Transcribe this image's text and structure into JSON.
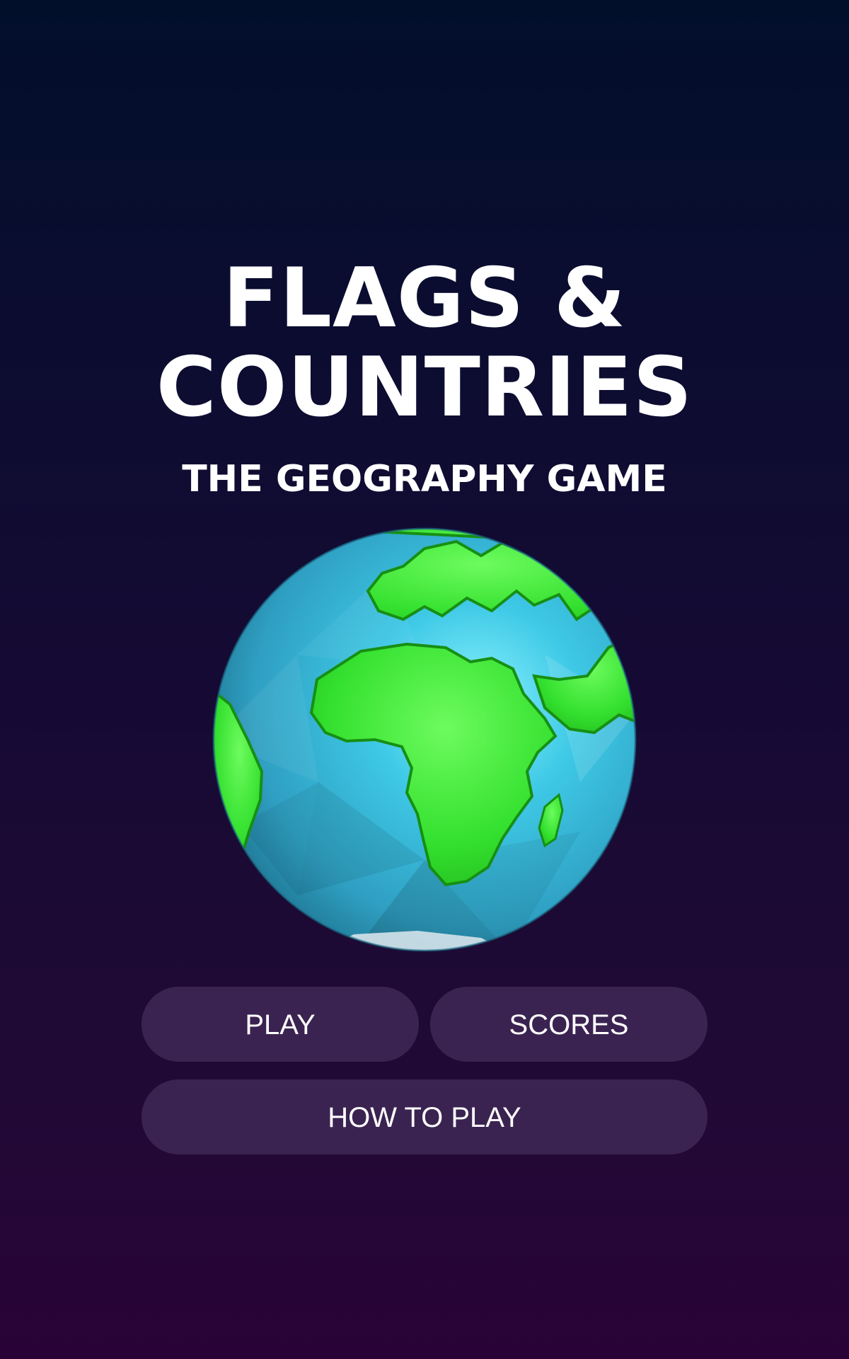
{
  "title": {
    "line1": "FLAGS &",
    "line2": "COUNTRIES"
  },
  "subtitle": "THE GEOGRAPHY GAME",
  "globe": {
    "icon": "earth-globe-icon",
    "ocean_color": "#3fb6d6",
    "land_color": "#35e03a"
  },
  "buttons": {
    "play": "PLAY",
    "scores": "SCORES",
    "how_to_play": "HOW TO PLAY"
  },
  "colors": {
    "background_top": "#020f2b",
    "background_bottom": "#290337",
    "button_bg": "#3b2351",
    "text": "#ffffff"
  }
}
